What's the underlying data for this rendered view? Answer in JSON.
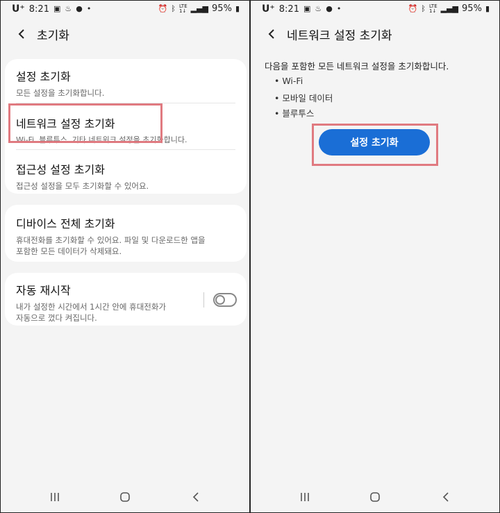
{
  "status_bar": {
    "carrier": "U⁺",
    "time": "8:21",
    "battery": "95%",
    "network_top": "LTE",
    "network_bottom": "1↓"
  },
  "left": {
    "title": "초기화",
    "items": [
      {
        "title": "설정 초기화",
        "sub": "모든 설정을 초기화합니다."
      },
      {
        "title": "네트워크 설정 초기화",
        "sub": "Wi-Fi, 블루투스, 기타 네트워크 설정을 초기화합니다."
      },
      {
        "title": "접근성 설정 초기화",
        "sub": "접근성 설정을 모두 초기화할 수 있어요."
      },
      {
        "title": "디바이스 전체 초기화",
        "sub1": "휴대전화를 초기화할 수 있어요. 파일 및 다운로드한 앱을",
        "sub2": "포함한 모든 데이터가 삭제돼요."
      },
      {
        "title": "자동 재시작",
        "sub1": "내가 설정한 시간에서 1시간 안에 휴대전화가",
        "sub2": "자동으로 껐다 켜집니다."
      }
    ]
  },
  "right": {
    "title": "네트워크 설정 초기화",
    "description": "다음을 포함한 모든 네트워크 설정을 초기화합니다.",
    "bullets": [
      "• Wi-Fi",
      "• 모바일 데이터",
      "• 블루투스"
    ],
    "button_label": "설정 초기화"
  },
  "colors": {
    "accent": "#1a6ed6",
    "highlight": "#e07a80"
  }
}
